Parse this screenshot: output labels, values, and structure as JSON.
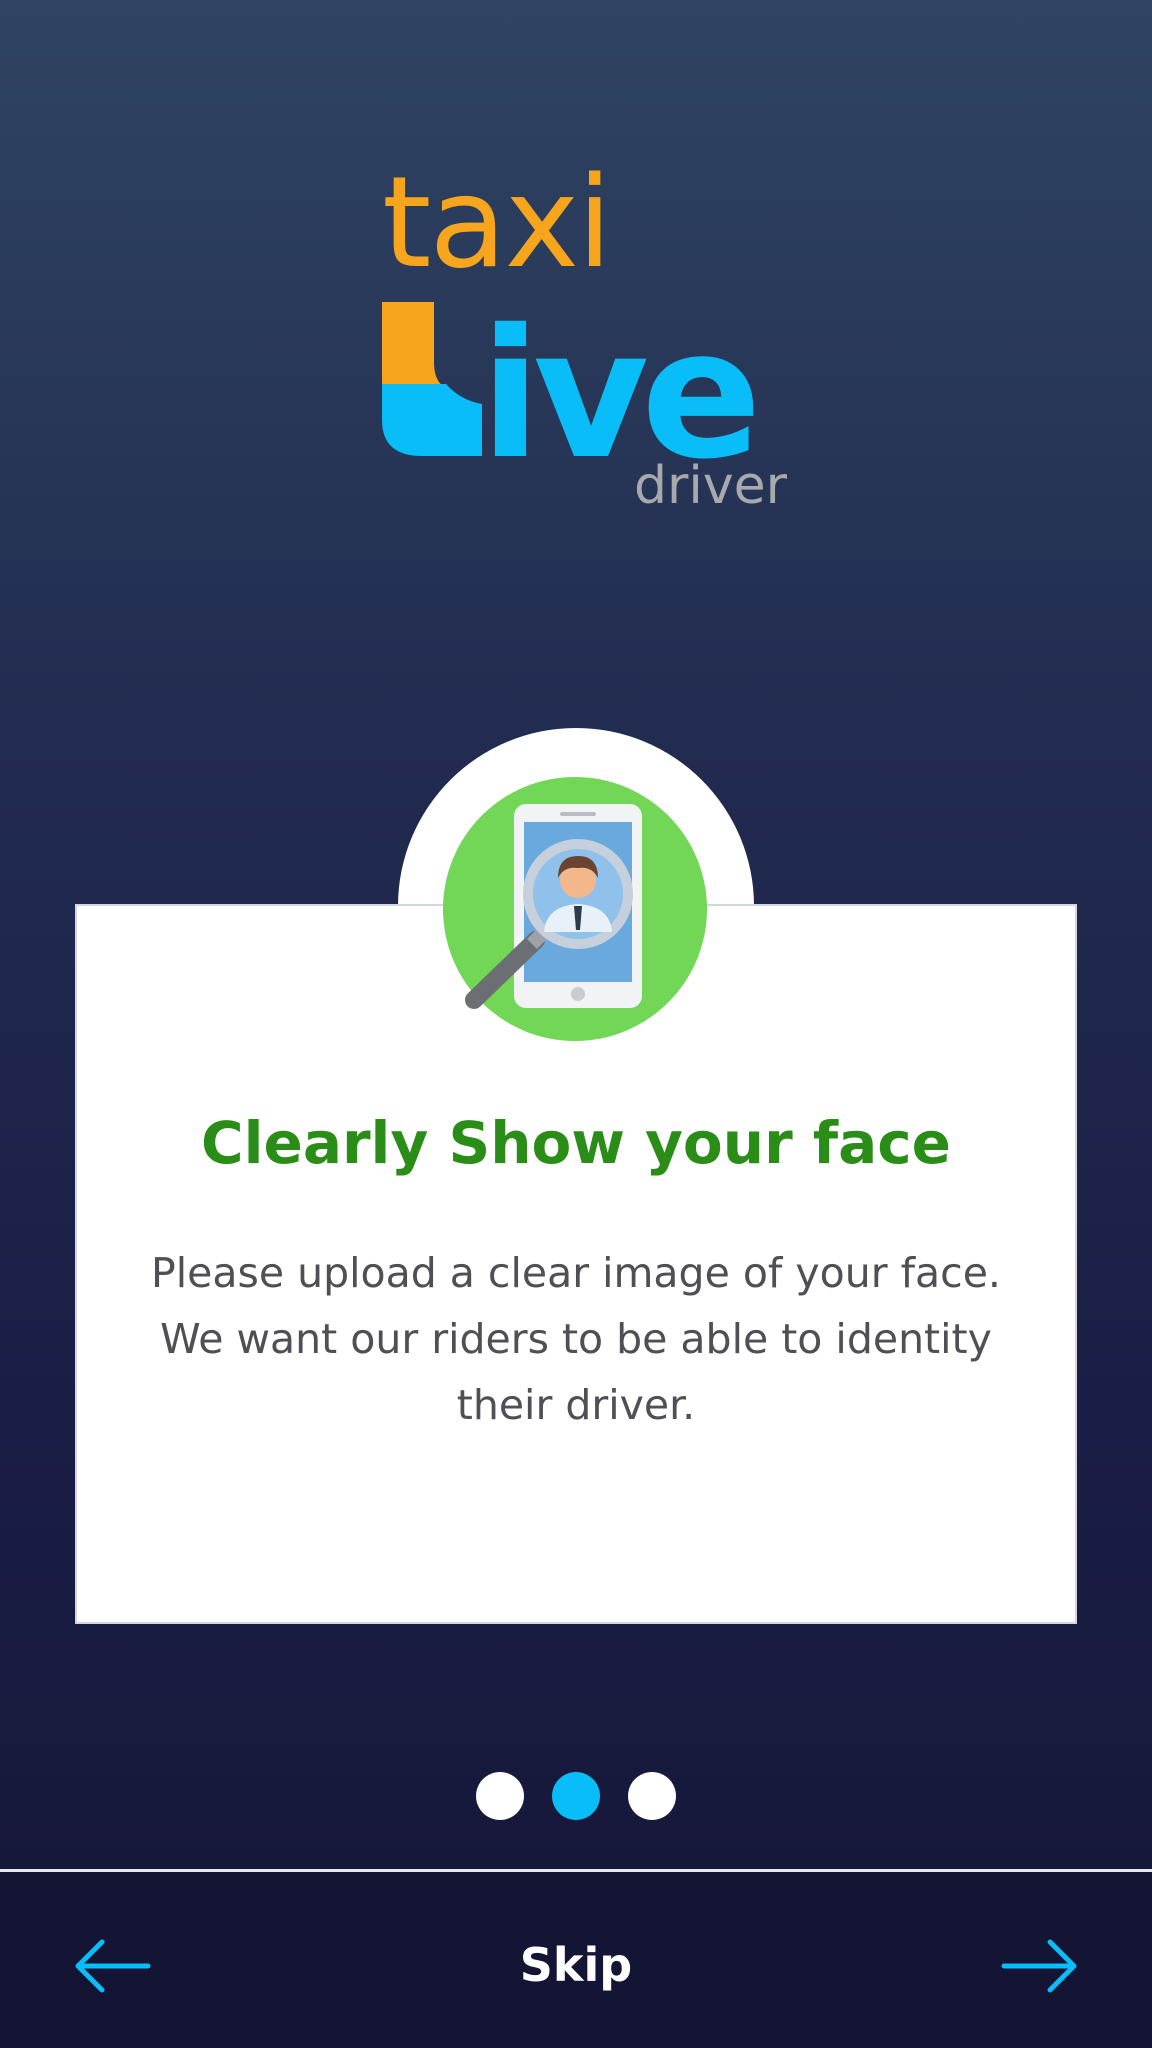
{
  "logo": {
    "taxi": "taxi",
    "live": "Live",
    "driver": "driver"
  },
  "card": {
    "title": "Clearly Show your face",
    "body_lines": [
      "Please upload a clear image of your face.",
      "We want our riders to be able to identity",
      "their driver."
    ],
    "icon": "phone-magnifier-face-icon"
  },
  "pager": {
    "total": 3,
    "active_index": 1
  },
  "bottom_bar": {
    "skip_label": "Skip",
    "prev_icon": "arrow-left-icon",
    "next_icon": "arrow-right-icon"
  },
  "colors": {
    "taxi_orange": "#f7a51c",
    "live_cyan": "#08bdf8",
    "title_green": "#2a8d17",
    "dot_active": "#08bdf8",
    "dot_inactive": "#ffffff",
    "icon_green": "#72d657"
  }
}
